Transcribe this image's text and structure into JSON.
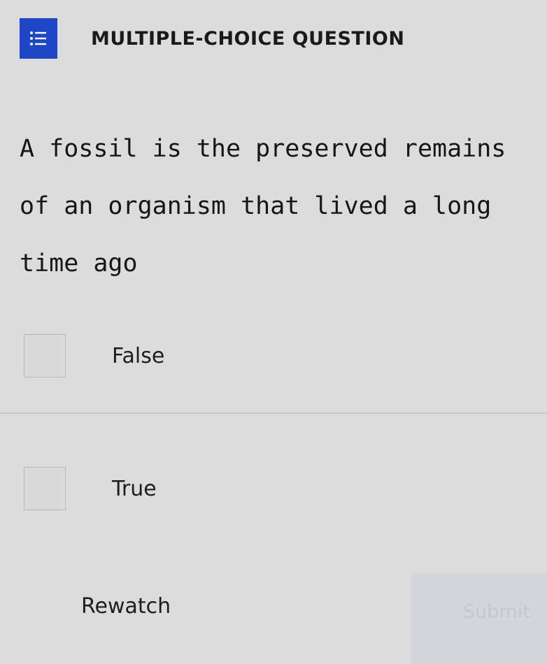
{
  "header": {
    "icon": "list-icon",
    "icon_color": "#1f46c6",
    "type_label": "MULTIPLE-CHOICE QUESTION"
  },
  "question": {
    "text": "A fossil is the preserved remains of an organism that lived a long time ago"
  },
  "options": [
    {
      "label": "False",
      "checked": false
    },
    {
      "label": "True",
      "checked": false
    }
  ],
  "actions": {
    "rewatch_label": "Rewatch",
    "submit_label": "Submit",
    "submit_disabled": true
  }
}
